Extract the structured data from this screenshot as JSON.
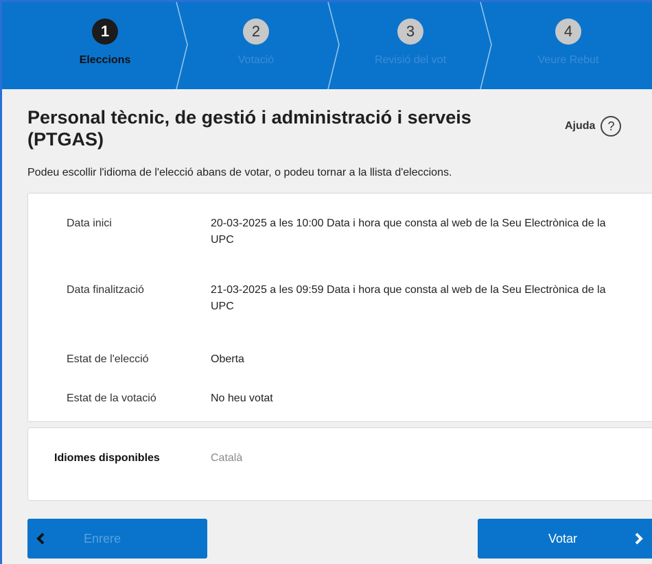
{
  "steps": [
    {
      "number": "1",
      "label": "Eleccions",
      "active": true
    },
    {
      "number": "2",
      "label": "Votació",
      "active": false
    },
    {
      "number": "3",
      "label": "Revisió del vot",
      "active": false
    },
    {
      "number": "4",
      "label": "Veure Rebut",
      "active": false
    }
  ],
  "header": {
    "title": "Personal tècnic, de gestió i administració i serveis (PTGAS)",
    "help_label": "Ajuda",
    "help_icon": "?"
  },
  "intro": "Podeu escollir l'idioma de l'elecció abans de votar, o podeu tornar a la llista d'eleccions.",
  "details": {
    "start_label": "Data inici",
    "start_value": "20-03-2025 a les 10:00 Data i hora que consta al web de la Seu Electrònica de la UPC",
    "end_label": "Data finalització",
    "end_value": "21-03-2025 a les 09:59 Data i hora que consta al web de la Seu Electrònica de la UPC",
    "election_status_label": "Estat de l'elecció",
    "election_status_value": "Oberta",
    "vote_status_label": "Estat de la votació",
    "vote_status_value": "No heu votat"
  },
  "languages": {
    "label": "Idiomes disponibles",
    "value": "Català"
  },
  "buttons": {
    "back_label": "Enrere",
    "vote_label": "Votar"
  },
  "colors": {
    "primary": "#0a74cc",
    "active_step": "#1c1c1c",
    "inactive_step": "#c8c8c8"
  }
}
